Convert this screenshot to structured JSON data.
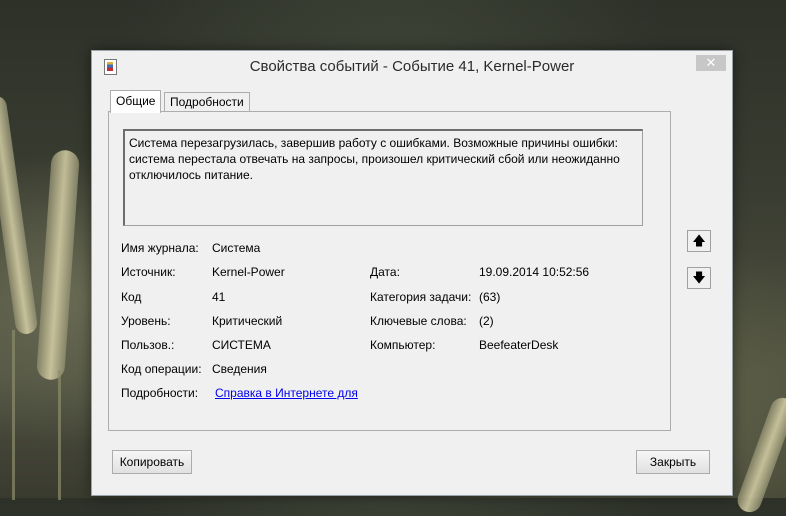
{
  "window": {
    "title": "Свойства событий - Событие 41, Kernel-Power",
    "close_glyph": "✕"
  },
  "tabs": [
    {
      "label": "Общие"
    },
    {
      "label": "Подробности"
    }
  ],
  "message": "Система перезагрузилась, завершив работу с ошибками. Возможные причины ошибки: система перестала отвечать на запросы, произошел критический сбой или неожиданно отключилось питание.",
  "fields": {
    "log_name": {
      "label": "Имя журнала:",
      "value": "Система"
    },
    "source": {
      "label": "Источник:",
      "value": "Kernel-Power"
    },
    "code": {
      "label": "Код",
      "value": "41"
    },
    "level": {
      "label": "Уровень:",
      "value": "Критический"
    },
    "user": {
      "label": "Пользов.:",
      "value": "СИСТЕМА"
    },
    "opcode": {
      "label": "Код операции:",
      "value": "Сведения"
    },
    "details": {
      "label": "Подробности:",
      "value": "Справка в Интернете для"
    },
    "date": {
      "label": "Дата:",
      "value": "19.09.2014 10:52:56"
    },
    "task": {
      "label": "Категория задачи:",
      "value": "(63)"
    },
    "keywords": {
      "label": "Ключевые слова:",
      "value": "(2)"
    },
    "computer": {
      "label": "Компьютер:",
      "value": "BeefeaterDesk"
    }
  },
  "nav": {
    "up_glyph": "🡅",
    "down_glyph": "🡇"
  },
  "buttons": {
    "copy": "Копировать",
    "close": "Закрыть"
  }
}
